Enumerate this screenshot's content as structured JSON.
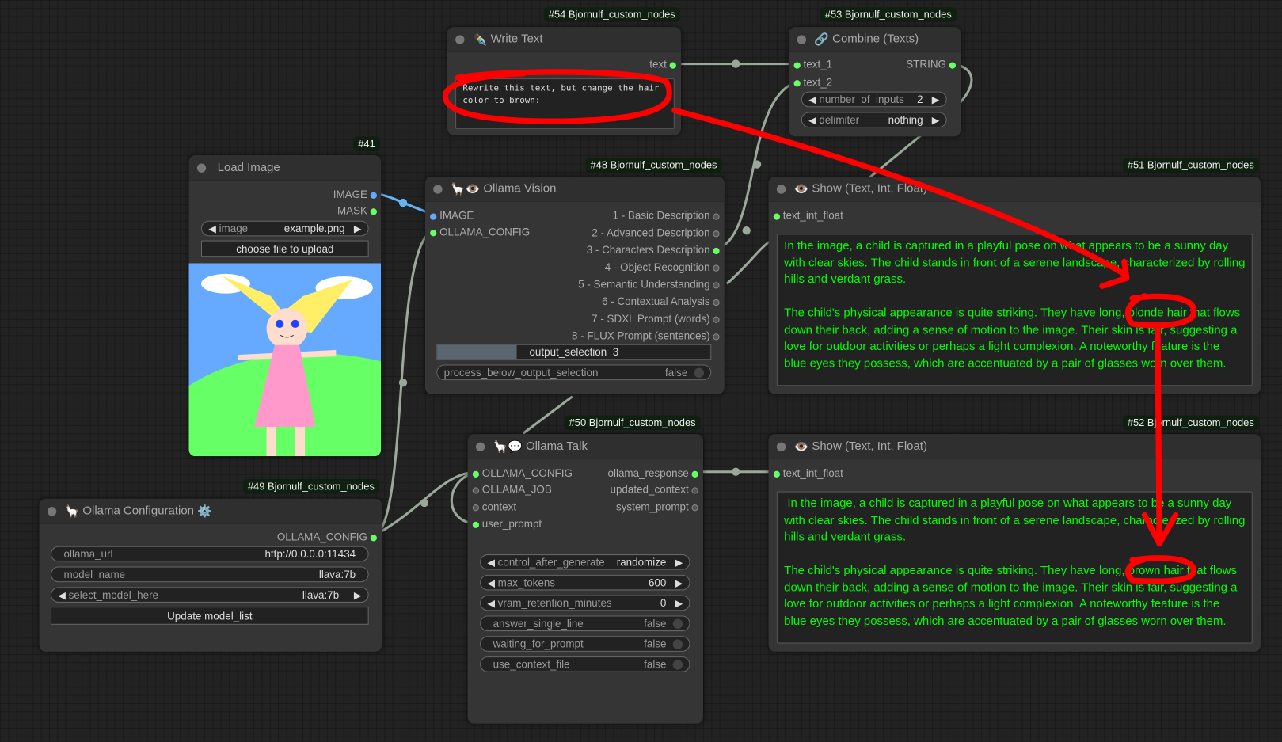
{
  "nodes": {
    "write_text": {
      "badge": "#54 Bjornulf_custom_nodes",
      "title": "Write Text",
      "icon": "pen-icon",
      "output": "text",
      "text": "Rewrite this text, but change the hair\ncolor to brown:"
    },
    "combine": {
      "badge": "#53 Bjornulf_custom_nodes",
      "title": "Combine (Texts)",
      "icon": "link-icon",
      "inputs": [
        "text_1",
        "text_2"
      ],
      "output": "STRING",
      "widgets": [
        {
          "label": "number_of_inputs",
          "value": "2"
        },
        {
          "label": "delimiter",
          "value": "nothing"
        }
      ]
    },
    "load_image": {
      "badge": "#41",
      "title": "Load Image",
      "outputs": [
        "IMAGE",
        "MASK"
      ],
      "image_label": "image",
      "image_value": "example.png",
      "upload_label": "choose file to upload"
    },
    "ollama_vision": {
      "badge": "#48 Bjornulf_custom_nodes",
      "title": "Ollama Vision",
      "icon": "llama-eye-icon",
      "inputs": [
        "IMAGE",
        "OLLAMA_CONFIG"
      ],
      "outputs": [
        "1 - Basic Description",
        "2 - Advanced Description",
        "3 - Characters Description",
        "4 - Object Recognition",
        "5 - Semantic Understanding",
        "6 - Contextual Analysis",
        "7 - SDXL Prompt (words)",
        "8 - FLUX Prompt (sentences)"
      ],
      "output_selection_label": "output_selection",
      "output_selection_value": "3",
      "output_selection_fraction": 0.29,
      "process_label": "process_below_output_selection",
      "process_value": "false"
    },
    "show_51": {
      "badge": "#51 Bjornulf_custom_nodes",
      "title": "Show (Text, Int, Float)",
      "input": "text_int_float",
      "text": "In the image, a child is captured in a playful pose on what appears to be a sunny day with clear skies. The child stands in front of a serene landscape, characterized by rolling hills and verdant grass.\n\nThe child's physical appearance is quite striking. They have long, blonde hair that flows down their back, adding a sense of motion to the image. Their skin is fair, suggesting a love for outdoor activities or perhaps a light complexion. A noteworthy feature is the blue eyes they possess, which are accentuated by a pair of glasses worn over them."
    },
    "ollama_talk": {
      "badge": "#50 Bjornulf_custom_nodes",
      "title": "Ollama Talk",
      "icon": "llama-speech-icon",
      "inputs": [
        "OLLAMA_CONFIG",
        "OLLAMA_JOB",
        "context",
        "user_prompt"
      ],
      "outputs": [
        "ollama_response",
        "updated_context",
        "system_prompt"
      ],
      "widgets": [
        {
          "label": "control_after_generate",
          "value": "randomize"
        },
        {
          "label": "max_tokens",
          "value": "600"
        },
        {
          "label": "vram_retention_minutes",
          "value": "0"
        }
      ],
      "toggles": [
        {
          "label": "answer_single_line",
          "value": "false"
        },
        {
          "label": "waiting_for_prompt",
          "value": "false"
        },
        {
          "label": "use_context_file",
          "value": "false"
        }
      ]
    },
    "show_52": {
      "badge": "#52 Bjornulf_custom_nodes",
      "title": "Show (Text, Int, Float)",
      "input": "text_int_float",
      "text": " In the image, a child is captured in a playful pose on what appears to be a sunny day with clear skies. The child stands in front of a serene landscape, characterized by rolling hills and verdant grass.\n\nThe child's physical appearance is quite striking. They have long, brown hair that flows down their back, adding a sense of motion to the image. Their skin is fair, suggesting a love for outdoor activities or perhaps a light complexion. A noteworthy feature is the blue eyes they possess, which are accentuated by a pair of glasses worn over them."
    },
    "ollama_config": {
      "badge": "#49 Bjornulf_custom_nodes",
      "title": "Ollama Configuration",
      "icon": "llama-gear-icon",
      "output": "OLLAMA_CONFIG",
      "widgets": [
        {
          "label": "ollama_url",
          "value": "http://0.0.0.0:11434"
        },
        {
          "label": "model_name",
          "value": "llava:7b"
        },
        {
          "label": "select_model_here",
          "value": "llava:7b"
        }
      ],
      "button": "Update model_list"
    }
  },
  "colors": {
    "link": "#9aa89a",
    "image_link": "#64b5f6",
    "annotation": "#ff0000",
    "output_text": "#00ff00"
  }
}
